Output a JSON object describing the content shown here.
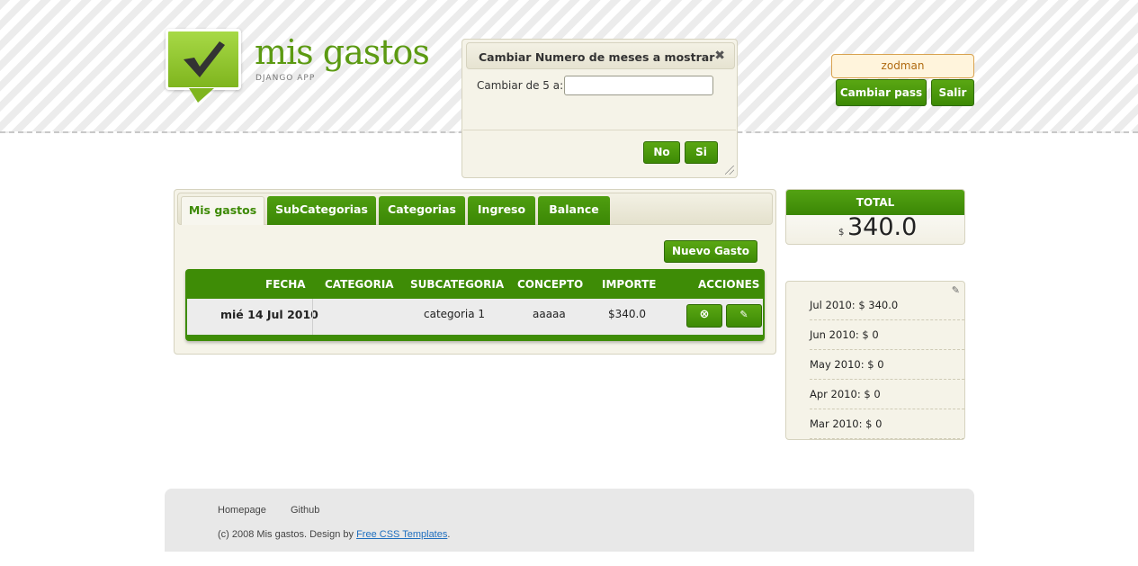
{
  "brand": {
    "title": "mis gastos",
    "subtitle": "DJANGO APP",
    "accent": "#5c9a12"
  },
  "dialog": {
    "title": "Cambiar Numero de meses a mostrar",
    "label": "Cambiar de 5 a:",
    "input_value": "",
    "no_label": "No",
    "si_label": "Si"
  },
  "user": {
    "name": "zodman",
    "change_pass_label": "Cambiar pass",
    "logout_label": "Salir"
  },
  "tabs": [
    {
      "label": "Mis gastos",
      "active": true
    },
    {
      "label": "SubCategorias",
      "active": false
    },
    {
      "label": "Categorias",
      "active": false
    },
    {
      "label": "Ingreso",
      "active": false
    },
    {
      "label": "Balance",
      "active": false
    }
  ],
  "actions": {
    "new_expense_label": "Nuevo Gasto"
  },
  "table": {
    "headers": [
      "FECHA",
      "CATEGORIA",
      "SUBCATEGORIA",
      "CONCEPTO",
      "IMPORTE",
      "ACCIONES"
    ],
    "rows": [
      {
        "fecha": "mié 14 Jul 2010",
        "categoria": "",
        "subcategoria": "categoria 1",
        "concepto": "aaaaa",
        "importe": "$340.0"
      }
    ]
  },
  "total": {
    "label": "TOTAL",
    "currency": "$",
    "value": "340.0"
  },
  "months": [
    "Jul 2010: $ 340.0",
    "Jun 2010: $ 0",
    "May 2010: $ 0",
    "Apr 2010: $ 0",
    "Mar 2010: $ 0"
  ],
  "footer": {
    "links": [
      "Homepage",
      "Github"
    ],
    "copy_prefix": "(c) 2008 Mis gastos. Design by ",
    "copy_link": "Free CSS Templates",
    "copy_suffix": "."
  }
}
